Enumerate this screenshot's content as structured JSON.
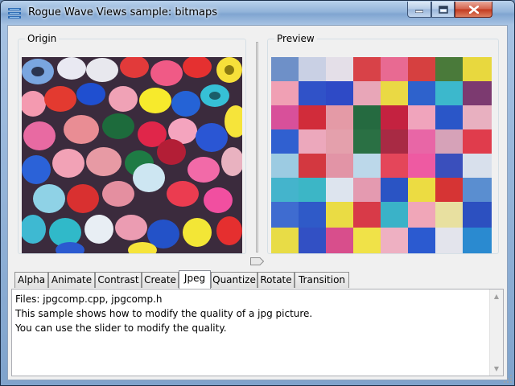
{
  "window": {
    "title": "Rogue Wave Views sample: bitmaps",
    "icons": {
      "app": "app-bitmaps-icon",
      "minimize": "minimize-icon",
      "maximize": "maximize-icon",
      "close": "close-icon"
    }
  },
  "panels": {
    "origin_label": "Origin",
    "preview_label": "Preview"
  },
  "slider": {
    "orientation": "vertical",
    "quality_level": 0.0
  },
  "tabs": [
    {
      "label": "Alpha",
      "active": false
    },
    {
      "label": "Animate",
      "active": false
    },
    {
      "label": "Contrast",
      "active": false
    },
    {
      "label": "Create",
      "active": false
    },
    {
      "label": "Jpeg",
      "active": true
    },
    {
      "label": "Quantize",
      "active": false
    },
    {
      "label": "Rotate",
      "active": false
    },
    {
      "label": "Transition",
      "active": false
    }
  ],
  "description": {
    "lines": [
      "Files: jpgcomp.cpp, jpgcomp.h",
      "This sample shows how to modify the quality of a jpg picture.",
      "You can use the slider to modify the quality."
    ]
  },
  "colors": {
    "accent_active_tab": "#ffffff",
    "titlebar": "#93b4da",
    "close_button": "#c2391e"
  }
}
